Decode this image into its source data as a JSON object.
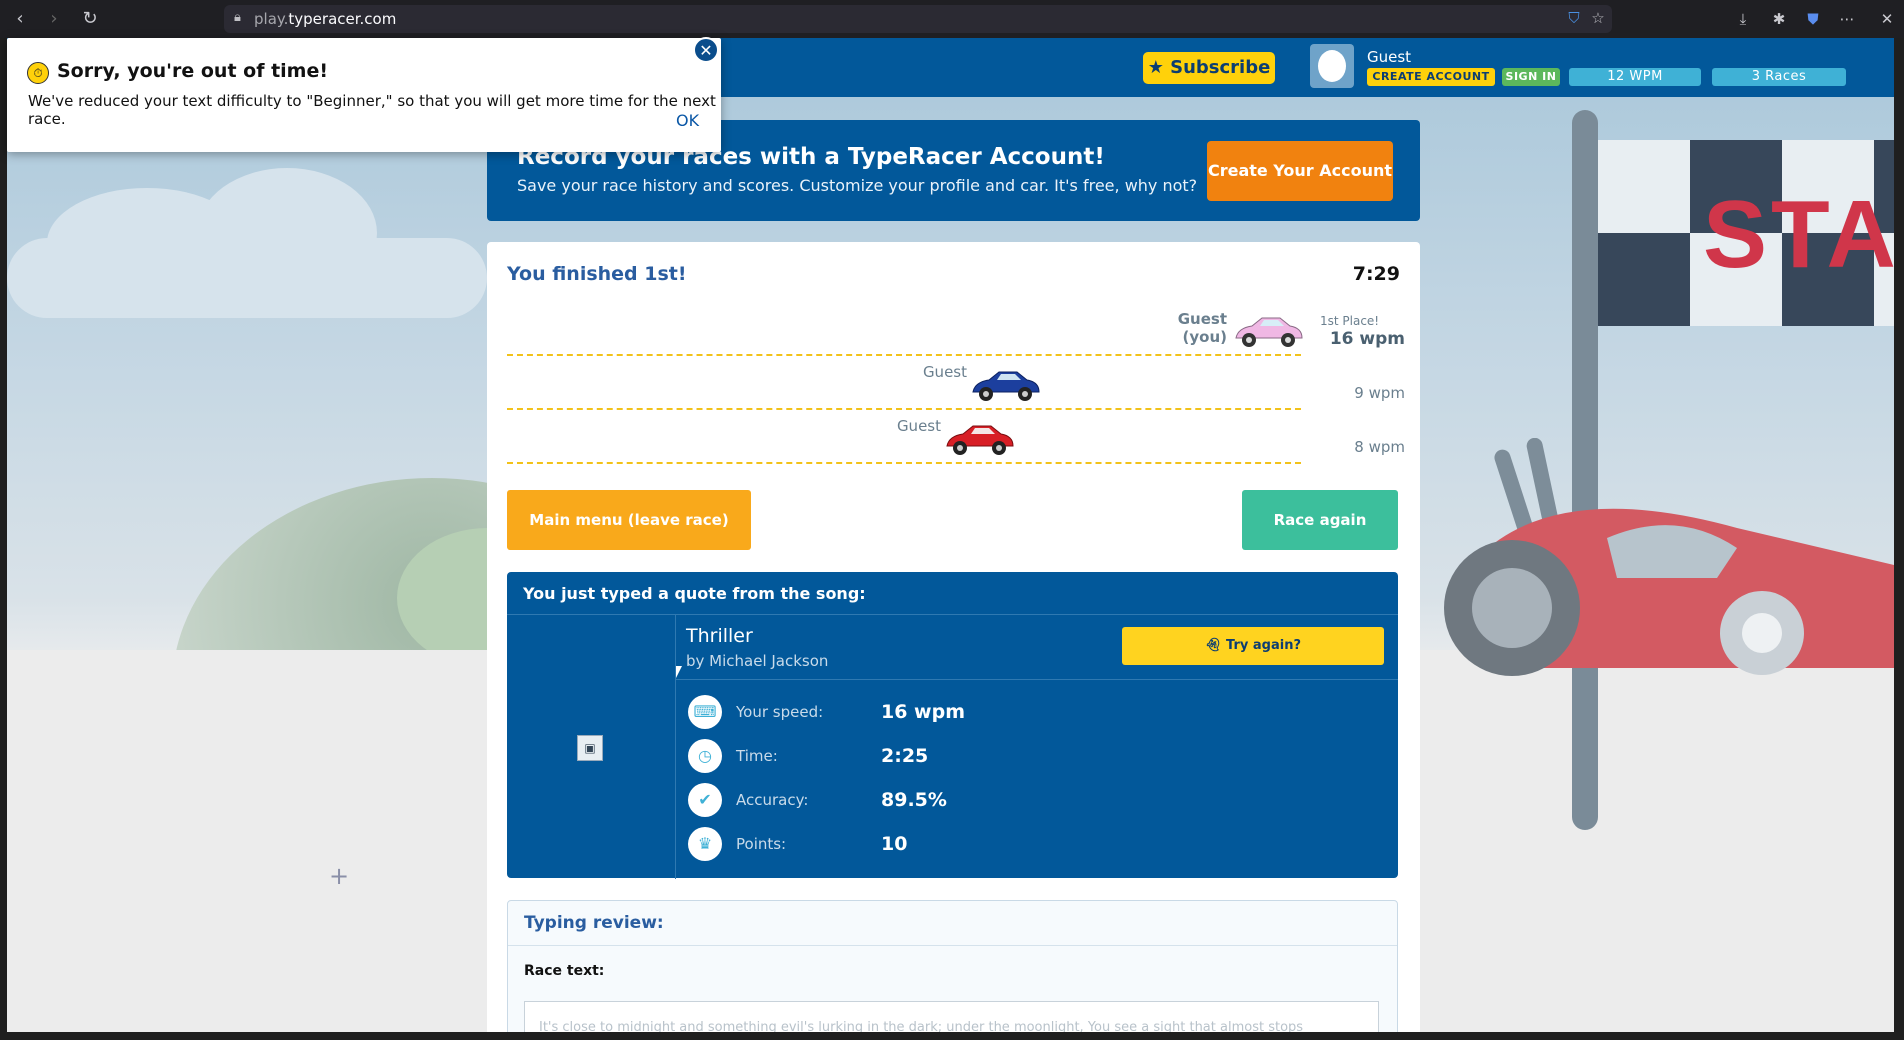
{
  "browser": {
    "url_dim": "play.",
    "url_main": "typeracer.com"
  },
  "header": {
    "subscribe_label": "★ Subscribe",
    "user_name": "Guest",
    "create_account_label": "CREATE ACCOUNT",
    "sign_in_label": "SIGN IN",
    "wpm_label": "12  WPM",
    "races_label": "3 Races"
  },
  "popup": {
    "title": "Sorry, you're out of time!",
    "message": "We've reduced your text difficulty to \"Beginner,\" so that you will get more time for the next race.",
    "ok_label": "OK"
  },
  "promo": {
    "title": "Record your races with a TypeRacer Account!",
    "subtitle": "Save your race history and scores. Customize your profile and car. It's free, why not?",
    "button_label": "Create Your Account"
  },
  "results": {
    "heading": "You finished 1st!",
    "timer": "7:29",
    "racers": [
      {
        "name": "Guest",
        "you_label": "(you)",
        "place": "1st Place!",
        "wpm": "16 wpm",
        "car_color": "#f0b8e4"
      },
      {
        "name": "Guest",
        "wpm": "9 wpm",
        "car_color": "#1c3f9e"
      },
      {
        "name": "Guest",
        "wpm": "8 wpm",
        "car_color": "#d81f26"
      }
    ],
    "main_menu_label": "Main menu (leave race)",
    "race_again_label": "Race again"
  },
  "quote": {
    "heading": "You just typed a quote from the song:",
    "title": "Thriller",
    "artist": "by Michael Jackson",
    "try_again_label": "Try again?",
    "stats": [
      {
        "icon": "keyboard-icon",
        "label": "Your speed:",
        "value": "16 wpm"
      },
      {
        "icon": "clock-icon",
        "label": "Time:",
        "value": "2:25"
      },
      {
        "icon": "checkmark-icon",
        "label": "Accuracy:",
        "value": "89.5%"
      },
      {
        "icon": "trophy-icon",
        "label": "Points:",
        "value": "10"
      }
    ]
  },
  "review": {
    "title": "Typing review:",
    "race_text_label": "Race text:",
    "race_text": "It's close to midnight and something evil's lurking in the dark; under the moonlight, You see a sight that almost stops"
  },
  "scene": {
    "sign_text": "STA"
  }
}
